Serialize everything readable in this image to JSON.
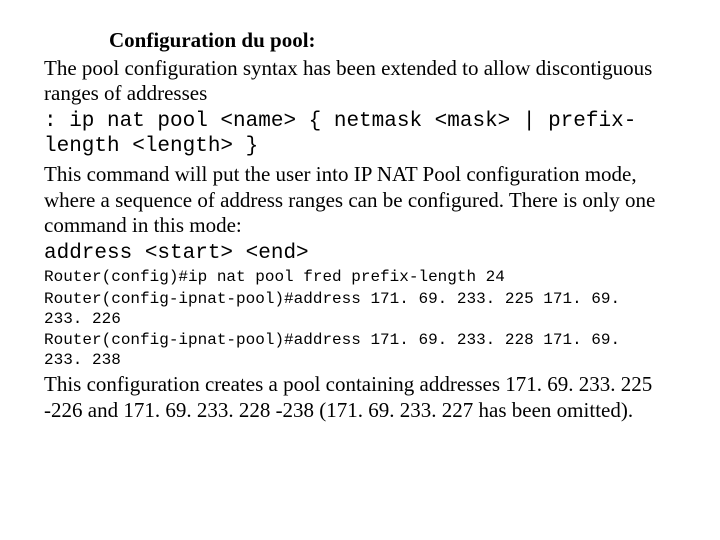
{
  "heading": "Configuration du pool:",
  "p1a": "The pool configuration syntax has been extended to allow discontiguous ranges of addresses",
  "syntax1": ": ip nat pool <name> { netmask <mask> | prefix-length <length> }",
  "p2": "This command will put the user into IP NAT Pool configuration mode, where a sequence of address ranges can be configured. There is only one command in this mode:",
  "syntax2": "address <start> <end>",
  "term1": "Router(config)#ip nat pool fred prefix-length 24",
  "term2": "Router(config-ipnat-pool)#address 171. 69. 233. 225 171. 69. 233. 226",
  "term3": "Router(config-ipnat-pool)#address 171. 69. 233. 228 171. 69. 233. 238",
  "p3": "This configuration creates a pool containing addresses 171. 69. 233. 225 -226 and 171. 69. 233. 228 -238 (171. 69. 233. 227 has been omitted)."
}
